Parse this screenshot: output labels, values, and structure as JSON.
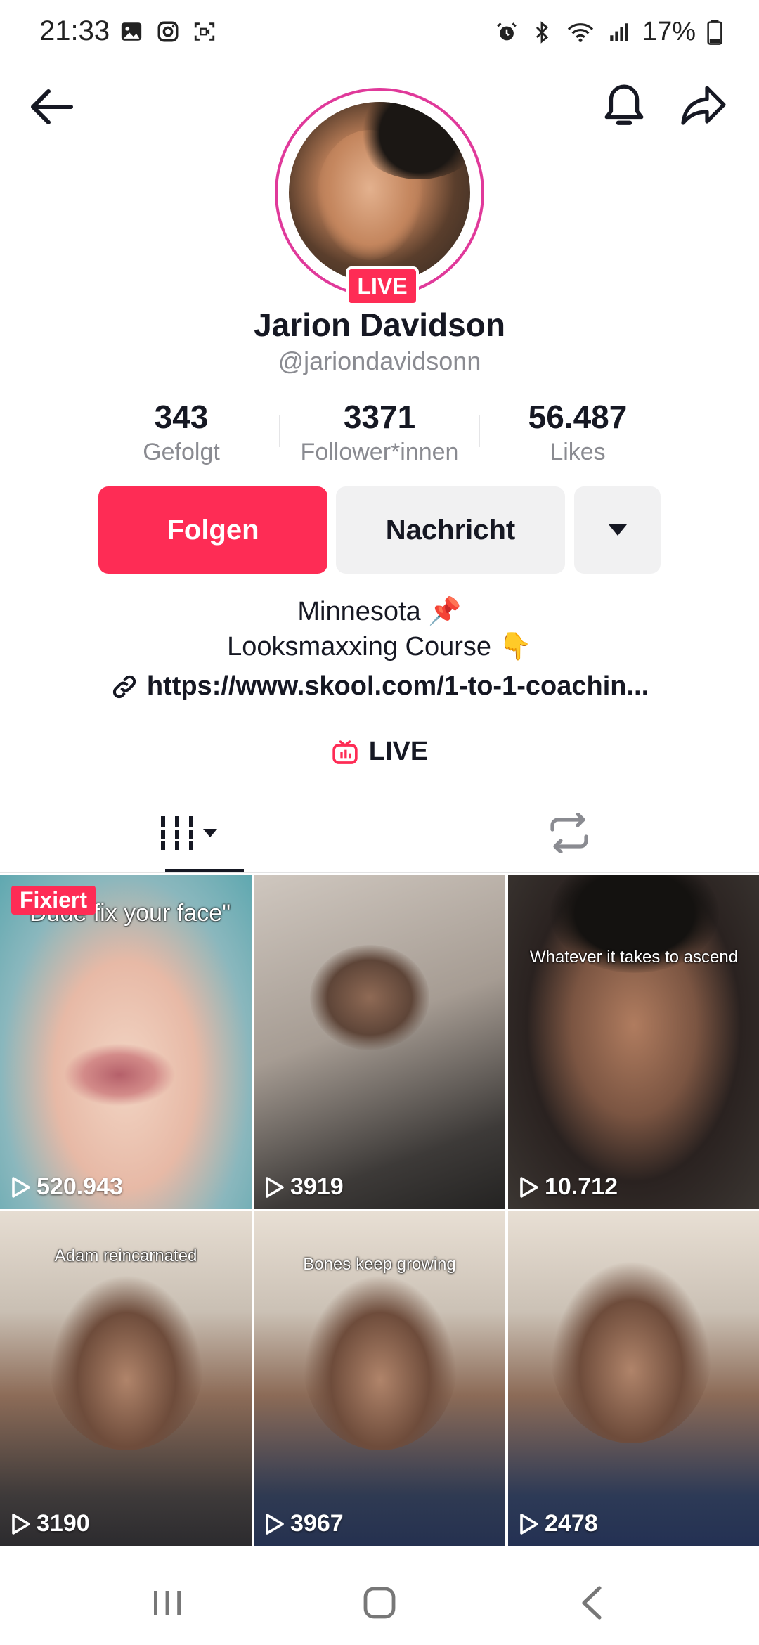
{
  "status": {
    "time": "21:33",
    "battery": "17%"
  },
  "profile": {
    "name": "Jarion Davidson",
    "handle": "@jariondavidsonn",
    "live_badge": "LIVE"
  },
  "stats": [
    {
      "value": "343",
      "label": "Gefolgt"
    },
    {
      "value": "3371",
      "label": "Follower*innen"
    },
    {
      "value": "56.487",
      "label": "Likes"
    }
  ],
  "actions": {
    "follow": "Folgen",
    "message": "Nachricht"
  },
  "bio": {
    "line1": "Minnesota 📌",
    "line2": "Looksmaxxing Course 👇",
    "link": "https://www.skool.com/1-to-1-coachin..."
  },
  "live_row": "LIVE",
  "videos": [
    {
      "views": "520.943",
      "caption": "\"Dude fix your face\"",
      "pinned": "Fixiert"
    },
    {
      "views": "3919",
      "caption": ""
    },
    {
      "views": "10.712",
      "caption": "Whatever it takes to ascend"
    },
    {
      "views": "3190",
      "caption": "Adam reincarnated"
    },
    {
      "views": "3967",
      "caption": "Bones keep growing"
    },
    {
      "views": "2478",
      "caption": ""
    }
  ],
  "colors": {
    "accent": "#fe2c55",
    "ring": "#e0399a"
  }
}
